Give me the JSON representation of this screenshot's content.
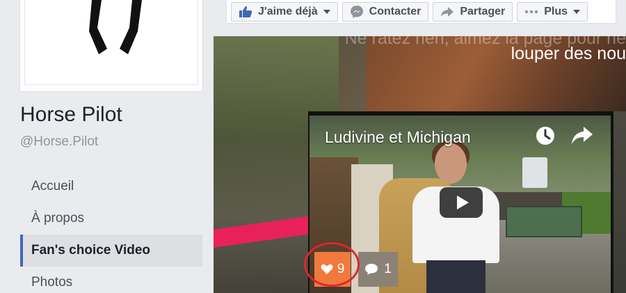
{
  "page": {
    "name": "Horse Pilot",
    "handle": "@Horse.Pilot"
  },
  "nav": {
    "items": [
      {
        "label": "Accueil"
      },
      {
        "label": "À propos"
      },
      {
        "label": "Fan's choice Video"
      },
      {
        "label": "Photos"
      }
    ],
    "active_index": 2
  },
  "actionbar": {
    "like_label": "J'aime déjà",
    "contact_label": "Contacter",
    "share_label": "Partager",
    "more_label": "Plus"
  },
  "overlay": {
    "line1": "Ne ratez rien, aimez la page pour ne",
    "line2": "louper des nou"
  },
  "video": {
    "title": "Ludivine et Michigan",
    "likes": "9",
    "comments": "1"
  },
  "colors": {
    "accent": "#4267b2",
    "like_badge": "#f1793e",
    "highlight_circle": "#e0262b",
    "brand_stripe": "#e8215a"
  }
}
